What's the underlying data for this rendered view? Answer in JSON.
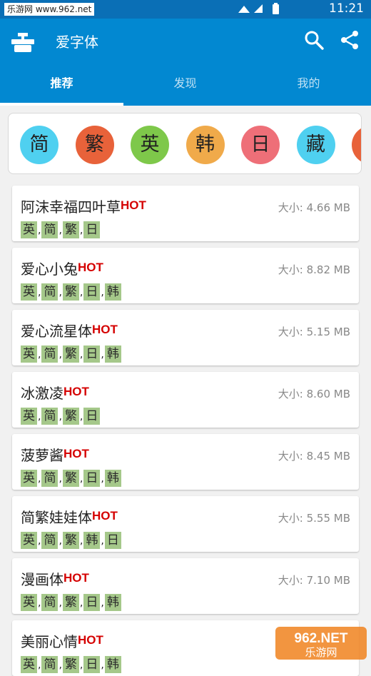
{
  "status_bar": {
    "watermark": "乐游网 www.962.net",
    "time": "11:21"
  },
  "app_bar": {
    "title": "爱字体"
  },
  "tabs": [
    {
      "label": "推荐",
      "active": true
    },
    {
      "label": "发现",
      "active": false
    },
    {
      "label": "我的",
      "active": false
    }
  ],
  "languages": [
    {
      "label": "简",
      "color": "#4fd0f0"
    },
    {
      "label": "繁",
      "color": "#e8623a"
    },
    {
      "label": "英",
      "color": "#7ec84a"
    },
    {
      "label": "韩",
      "color": "#f0aa4a"
    },
    {
      "label": "日",
      "color": "#ee6f78"
    },
    {
      "label": "藏",
      "color": "#4fd0f0"
    },
    {
      "label": "",
      "color": "#e8623a"
    }
  ],
  "fonts": [
    {
      "name": "阿沫幸福四叶草",
      "hot": "HOT",
      "size": "大小: 4.66 MB",
      "tags": [
        "英",
        "简",
        "繁",
        "日"
      ]
    },
    {
      "name": "爱心小兔",
      "hot": "HOT",
      "size": "大小: 8.82 MB",
      "tags": [
        "英",
        "简",
        "繁",
        "日",
        "韩"
      ]
    },
    {
      "name": "爱心流星体",
      "hot": "HOT",
      "size": "大小: 5.15 MB",
      "tags": [
        "英",
        "简",
        "繁",
        "日",
        "韩"
      ]
    },
    {
      "name": "冰激凌",
      "hot": "HOT",
      "size": "大小: 8.60 MB",
      "tags": [
        "英",
        "简",
        "繁",
        "日"
      ]
    },
    {
      "name": "菠萝酱",
      "hot": "HOT",
      "size": "大小: 8.45 MB",
      "tags": [
        "英",
        "简",
        "繁",
        "日",
        "韩"
      ]
    },
    {
      "name": "简繁娃娃体",
      "hot": "HOT",
      "size": "大小: 5.55 MB",
      "tags": [
        "英",
        "简",
        "繁",
        "韩",
        "日"
      ]
    },
    {
      "name": "漫画体",
      "hot": "HOT",
      "size": "大小: 7.10 MB",
      "tags": [
        "英",
        "简",
        "繁",
        "日",
        "韩"
      ]
    },
    {
      "name": "美丽心情",
      "hot": "HOT",
      "size": "",
      "tags": [
        "英",
        "简",
        "繁",
        "日",
        "韩"
      ]
    }
  ],
  "watermark_logo": {
    "text_top": "962.NET",
    "text_bottom": "乐游网"
  }
}
